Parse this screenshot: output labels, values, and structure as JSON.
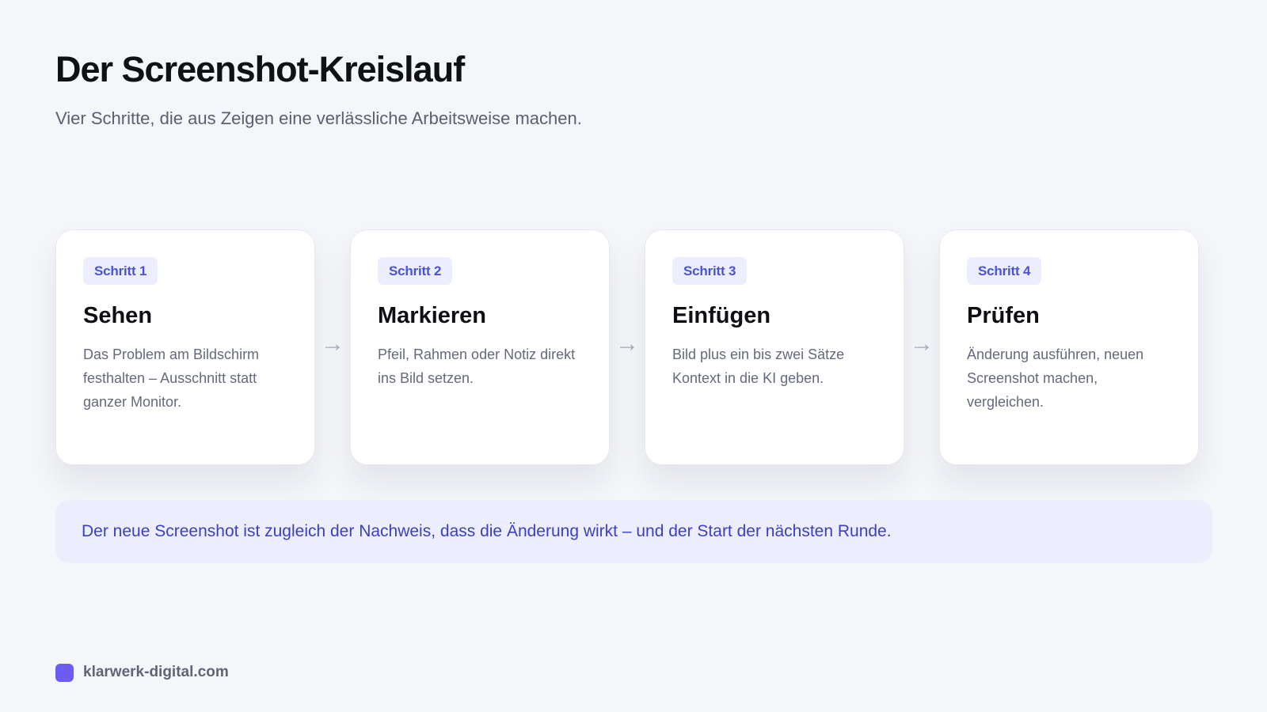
{
  "header": {
    "title": "Der Screenshot-Kreislauf",
    "subtitle": "Vier Schritte, die aus Zeigen eine verlässliche Arbeitsweise machen."
  },
  "steps": [
    {
      "badge": "Schritt 1",
      "title": "Sehen",
      "text": "Das Problem am Bildschirm festhalten – Ausschnitt statt ganzer Monitor."
    },
    {
      "badge": "Schritt 2",
      "title": "Markieren",
      "text": "Pfeil, Rahmen oder Notiz direkt ins Bild setzen."
    },
    {
      "badge": "Schritt 3",
      "title": "Einfügen",
      "text": "Bild plus ein bis zwei Sätze Kontext in die KI geben."
    },
    {
      "badge": "Schritt 4",
      "title": "Prüfen",
      "text": "Änderung ausführen, neuen Screenshot machen, vergleichen."
    }
  ],
  "arrows": [
    "→",
    "→",
    "→"
  ],
  "note": "Der neue Screenshot ist zugleich der Nachweis, dass die Änderung wirkt – und der Start der nächsten Runde.",
  "footer": {
    "brand": "klarwerk-digital.com"
  },
  "colors": {
    "background": "#f5f6fa",
    "accent": "#4c52d6",
    "accent_soft": "#eceefd",
    "logo": "#6c5cf2"
  },
  "icons": {
    "arrow": "arrow-right-icon",
    "logo": "logo-square-icon"
  }
}
